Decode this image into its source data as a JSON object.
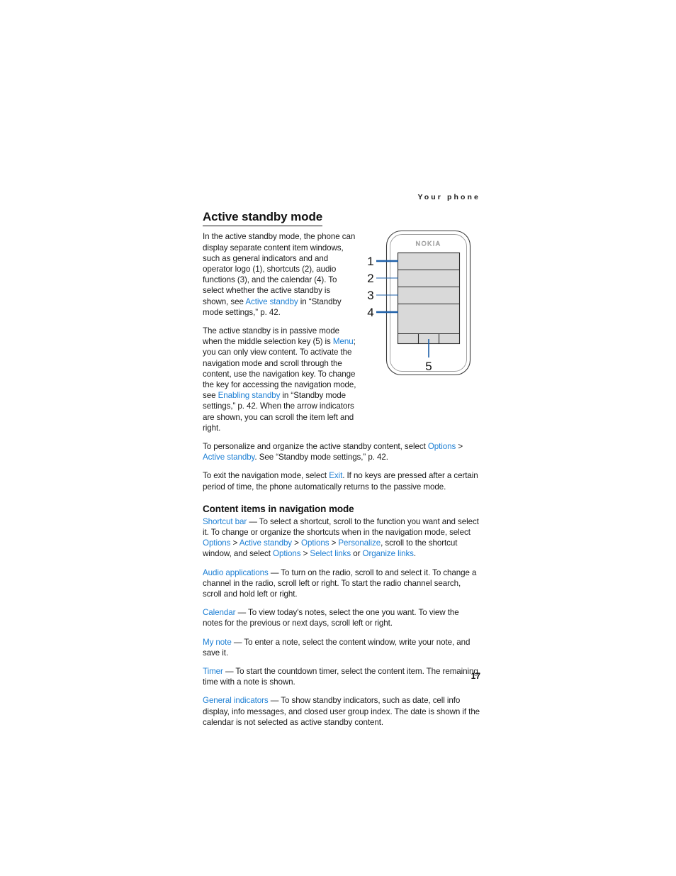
{
  "header": {
    "running_head": "Your phone"
  },
  "folio": {
    "page_number": "17"
  },
  "colors": {
    "link": "#1d7fd4",
    "text": "#1a1a1a",
    "screen_fill": "#d9d9d9",
    "leader": "#1d5fa8"
  },
  "section": {
    "title": "Active standby mode",
    "paragraphs": {
      "p1_a": "In the active standby mode, the phone can display separate content item windows, such as general indicators and and operator logo (1), shortcuts (2), audio functions (3), and the calendar (4). To select whether the active standby is shown, see ",
      "p1_link": "Active standby",
      "p1_b": " in “Standby mode settings,” p. 42.",
      "p2_a": "The active standby is in passive mode when the middle selection key (5) is ",
      "p2_link1": "Menu",
      "p2_b": "; you can only view content. To activate the navigation mode and scroll through the content, use the navigation key. To change the key for accessing the navigation mode, see ",
      "p2_link2": "Enabling standby",
      "p2_c": " in “Standby mode settings,” p. 42. When the arrow indicators are shown, you can scroll the item left and right.",
      "p3_a": "To personalize and organize the active standby content, select ",
      "p3_link1": "Options",
      "p3_gt1": " > ",
      "p3_link2": "Active standby",
      "p3_b": ". See “Standby mode settings,” p. 42.",
      "p4_a": "To exit the navigation mode, select ",
      "p4_link1": "Exit",
      "p4_b": ". If no keys are pressed after a certain period of time, the phone automatically returns to the passive mode."
    }
  },
  "subsection": {
    "title": "Content items in navigation mode",
    "items": {
      "shortcut_bar": {
        "term": "Shortcut bar",
        "dash": " — ",
        "t1": "To select a shortcut, scroll to the function you want and select it. To change or organize the shortcuts when in the navigation mode, select ",
        "l1": "Options",
        "g1": " > ",
        "l2": "Active standby",
        "g2": " > ",
        "l3": "Options",
        "g3": " > ",
        "l4": "Personalize",
        "t2": ", scroll to the shortcut window, and select ",
        "l5": "Options",
        "g4": " > ",
        "l6": "Select links",
        "t3": " or ",
        "l7": "Organize links",
        "t4": "."
      },
      "audio_applications": {
        "term": "Audio applications",
        "dash": " — ",
        "text": "To turn on the radio, scroll to and select it. To change a channel in the radio, scroll left or right. To start the radio channel search, scroll and hold left or right."
      },
      "calendar": {
        "term": "Calendar",
        "dash": " — ",
        "text": "To view today's notes, select the one you want. To view the notes for the previous or next days, scroll left or right."
      },
      "my_note": {
        "term": "My note",
        "dash": " — ",
        "text": "To enter a note, select the content window, write your note, and save it."
      },
      "timer": {
        "term": "Timer",
        "dash": " — ",
        "text": "To start the countdown timer, select the content item. The remaining time with a note is shown."
      },
      "general_indicators": {
        "term": "General indicators",
        "dash": " — ",
        "text": "To show standby indicators, such as date, cell info display, info messages, and closed user group index. The date is shown if the calendar is not selected as active standby content."
      }
    }
  },
  "figure": {
    "brand_label": "NOKIA",
    "callouts": [
      {
        "number": "1",
        "target": "general-indicators-and-operator-logo"
      },
      {
        "number": "2",
        "target": "shortcuts"
      },
      {
        "number": "3",
        "target": "audio-functions"
      },
      {
        "number": "4",
        "target": "calendar"
      },
      {
        "number": "5",
        "target": "middle-selection-key"
      }
    ]
  }
}
